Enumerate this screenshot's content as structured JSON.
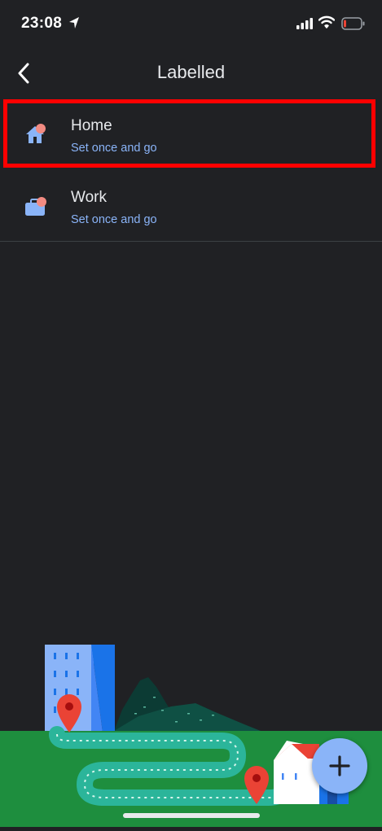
{
  "status_bar": {
    "time": "23:08"
  },
  "header": {
    "title": "Labelled"
  },
  "list": {
    "items": [
      {
        "title": "Home",
        "subtitle": "Set once and go"
      },
      {
        "title": "Work",
        "subtitle": "Set once and go"
      }
    ]
  },
  "colors": {
    "background": "#202124",
    "accent": "#8ab4f8",
    "highlight": "#ff0000",
    "icon_dot": "#f28b82"
  }
}
